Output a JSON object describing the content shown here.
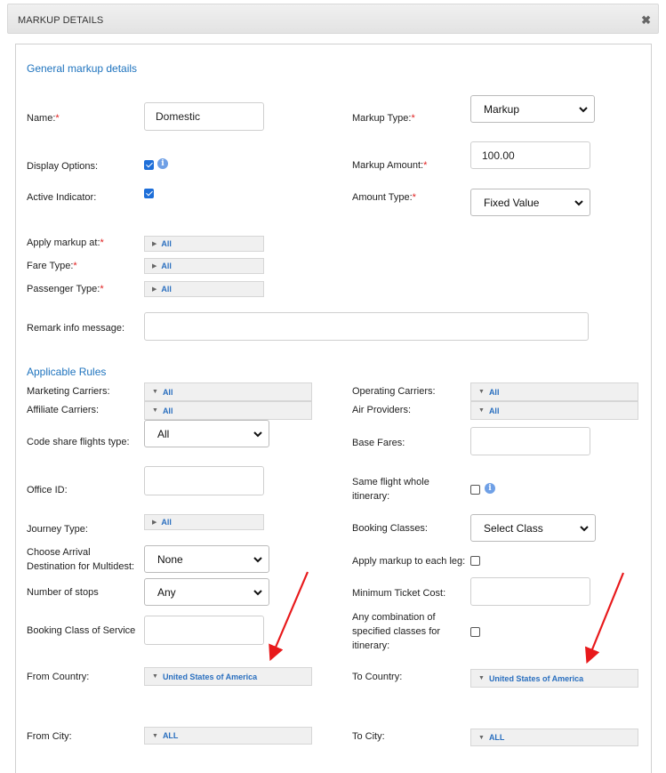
{
  "dialog": {
    "title": "MARKUP DETAILS",
    "close_glyph": "✖"
  },
  "general": {
    "heading": "General markup details",
    "name_label": "Name:",
    "name_value": "Domestic",
    "markup_type_label": "Markup Type:",
    "markup_type_value": "Markup",
    "display_options_label": "Display Options:",
    "markup_amount_label": "Markup Amount:",
    "markup_amount_value": "100.00",
    "active_indicator_label": "Active Indicator:",
    "amount_type_label": "Amount Type:",
    "amount_type_value": "Fixed Value",
    "apply_markup_at_label": "Apply markup at:",
    "apply_markup_at_value": "All",
    "fare_type_label": "Fare Type:",
    "fare_type_value": "All",
    "passenger_type_label": "Passenger Type:",
    "passenger_type_value": "All",
    "remark_label": "Remark info message:",
    "remark_value": ""
  },
  "rules": {
    "heading": "Applicable Rules",
    "marketing_carriers_label": "Marketing Carriers:",
    "marketing_carriers_value": "All",
    "operating_carriers_label": "Operating Carriers:",
    "operating_carriers_value": "All",
    "affiliate_carriers_label": "Affiliate Carriers:",
    "affiliate_carriers_value": "All",
    "air_providers_label": "Air Providers:",
    "air_providers_value": "All",
    "code_share_label": "Code share flights type:",
    "code_share_value": "All",
    "base_fares_label": "Base Fares:",
    "base_fares_value": "",
    "office_id_label": "Office ID:",
    "office_id_value": "",
    "same_flight_label_1": "Same flight whole",
    "same_flight_label_2": "itinerary:",
    "journey_type_label": "Journey Type:",
    "journey_type_value": "All",
    "booking_classes_label": "Booking Classes:",
    "booking_classes_value": "Select Class",
    "arrival_dest_label_1": "Choose Arrival",
    "arrival_dest_label_2": "Destination for Multidest:",
    "arrival_dest_value": "None",
    "apply_each_leg_label": "Apply markup to each leg:",
    "stops_label": "Number of stops",
    "stops_value": "Any",
    "min_ticket_label": "Minimum Ticket Cost:",
    "min_ticket_value": "",
    "booking_class_service_label": "Booking Class of Service",
    "booking_class_service_value": "",
    "any_combo_label_1": "Any combination of",
    "any_combo_label_2": "specified classes for",
    "any_combo_label_3": "itinerary:",
    "from_country_label": "From Country:",
    "from_country_value": "United States of America",
    "to_country_label": "To Country:",
    "to_country_value": "United States of America",
    "from_city_label": "From City:",
    "from_city_value": "ALL",
    "to_city_label": "To City:",
    "to_city_value": "ALL"
  },
  "colors": {
    "accent": "#1e73be",
    "required": "#e02020",
    "arrow": "#e8191b"
  }
}
